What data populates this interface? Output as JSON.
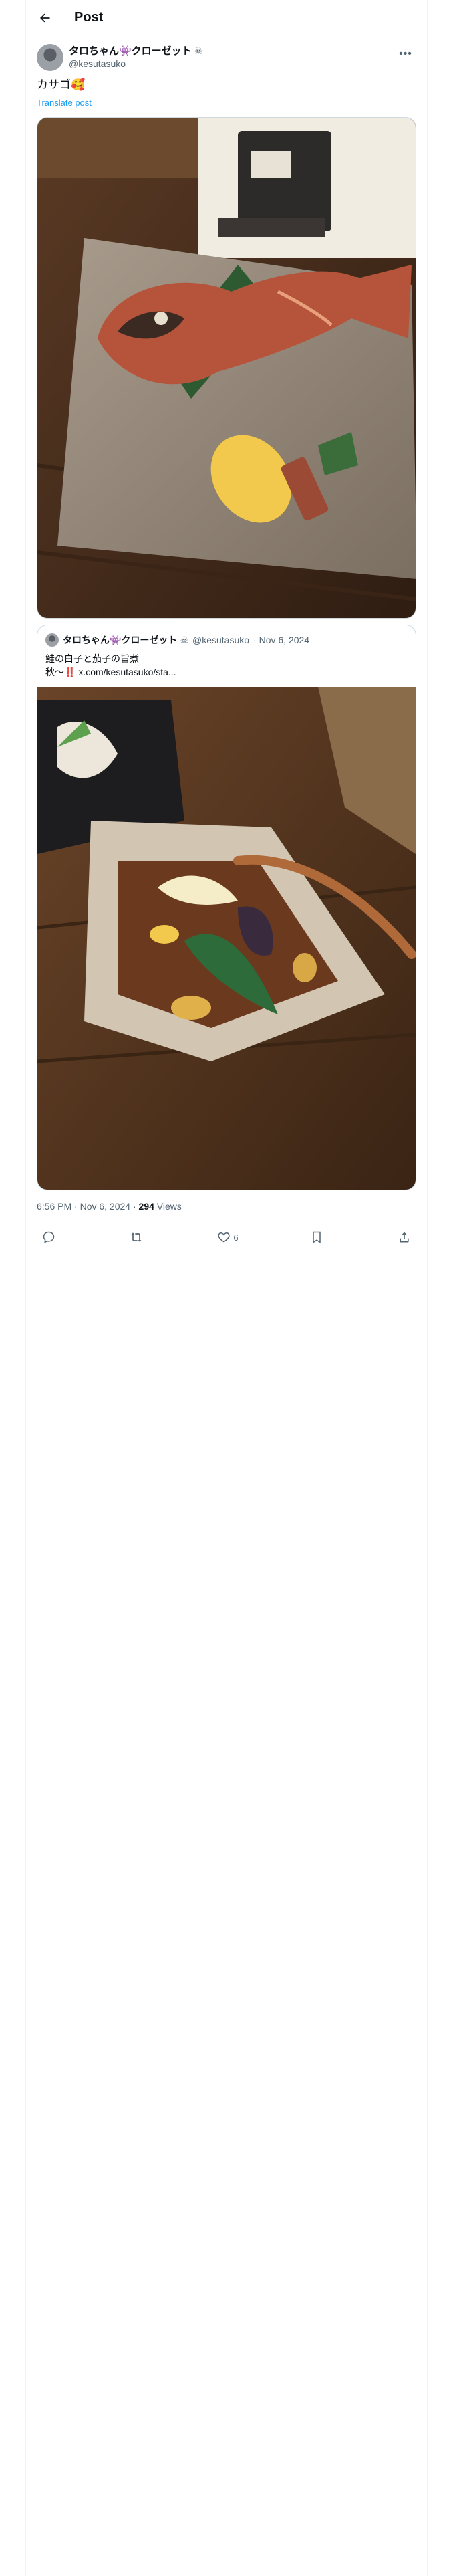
{
  "header": {
    "title": "Post"
  },
  "post": {
    "author": {
      "display_name": "タロちゃん👾クローゼット",
      "badge": "☠",
      "handle": "@kesutasuko"
    },
    "text": "カサゴ🥰",
    "translate_label": "Translate post",
    "timestamp": "6:56 PM · Nov 6, 2024",
    "separator": " · ",
    "views_count": "294",
    "views_label": " Views"
  },
  "quote": {
    "display_name": "タロちゃん👾クローゼット",
    "badge": "☠",
    "handle": "@kesutasuko",
    "date": "· Nov 6, 2024",
    "line1": "鮭の白子と茄子の旨煮",
    "line2": "秋〜‼️ x.com/kesutasuko/sta..."
  },
  "actions": {
    "reply_count": "",
    "repost_count": "",
    "like_count": "6",
    "bookmark_count": ""
  },
  "icons": [
    "back-arrow-icon",
    "more-icon",
    "reply-icon",
    "repost-icon",
    "like-icon",
    "bookmark-icon",
    "share-icon"
  ]
}
